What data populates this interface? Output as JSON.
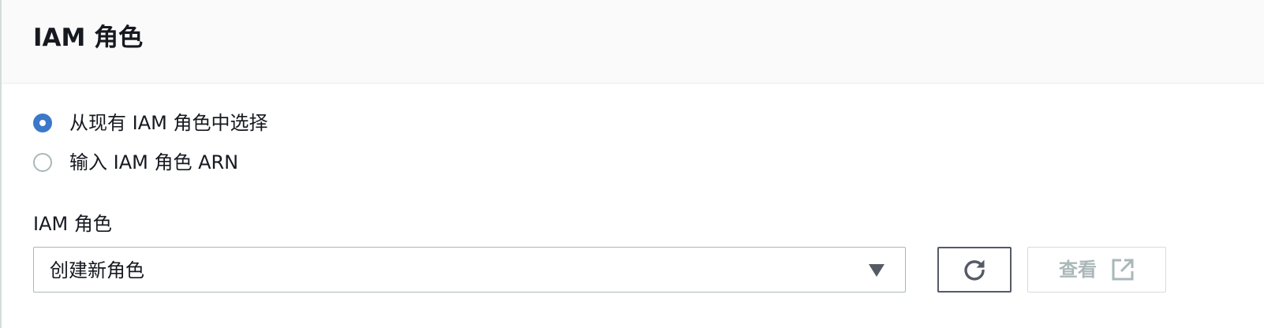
{
  "panel": {
    "title": "IAM 角色"
  },
  "radio_options": [
    {
      "label": "从现有 IAM 角色中选择",
      "checked": true
    },
    {
      "label": "输入 IAM 角色 ARN",
      "checked": false
    }
  ],
  "iam_role_field": {
    "label": "IAM 角色",
    "selected_value": "创建新角色"
  },
  "buttons": {
    "view_label": "查看",
    "view_enabled": false
  },
  "icons": {
    "caret": "caret-down-icon",
    "refresh": "refresh-icon",
    "external_link": "external-link-icon"
  },
  "colors": {
    "accent": "#3b78c9",
    "disabled_text": "#aab7b8"
  }
}
